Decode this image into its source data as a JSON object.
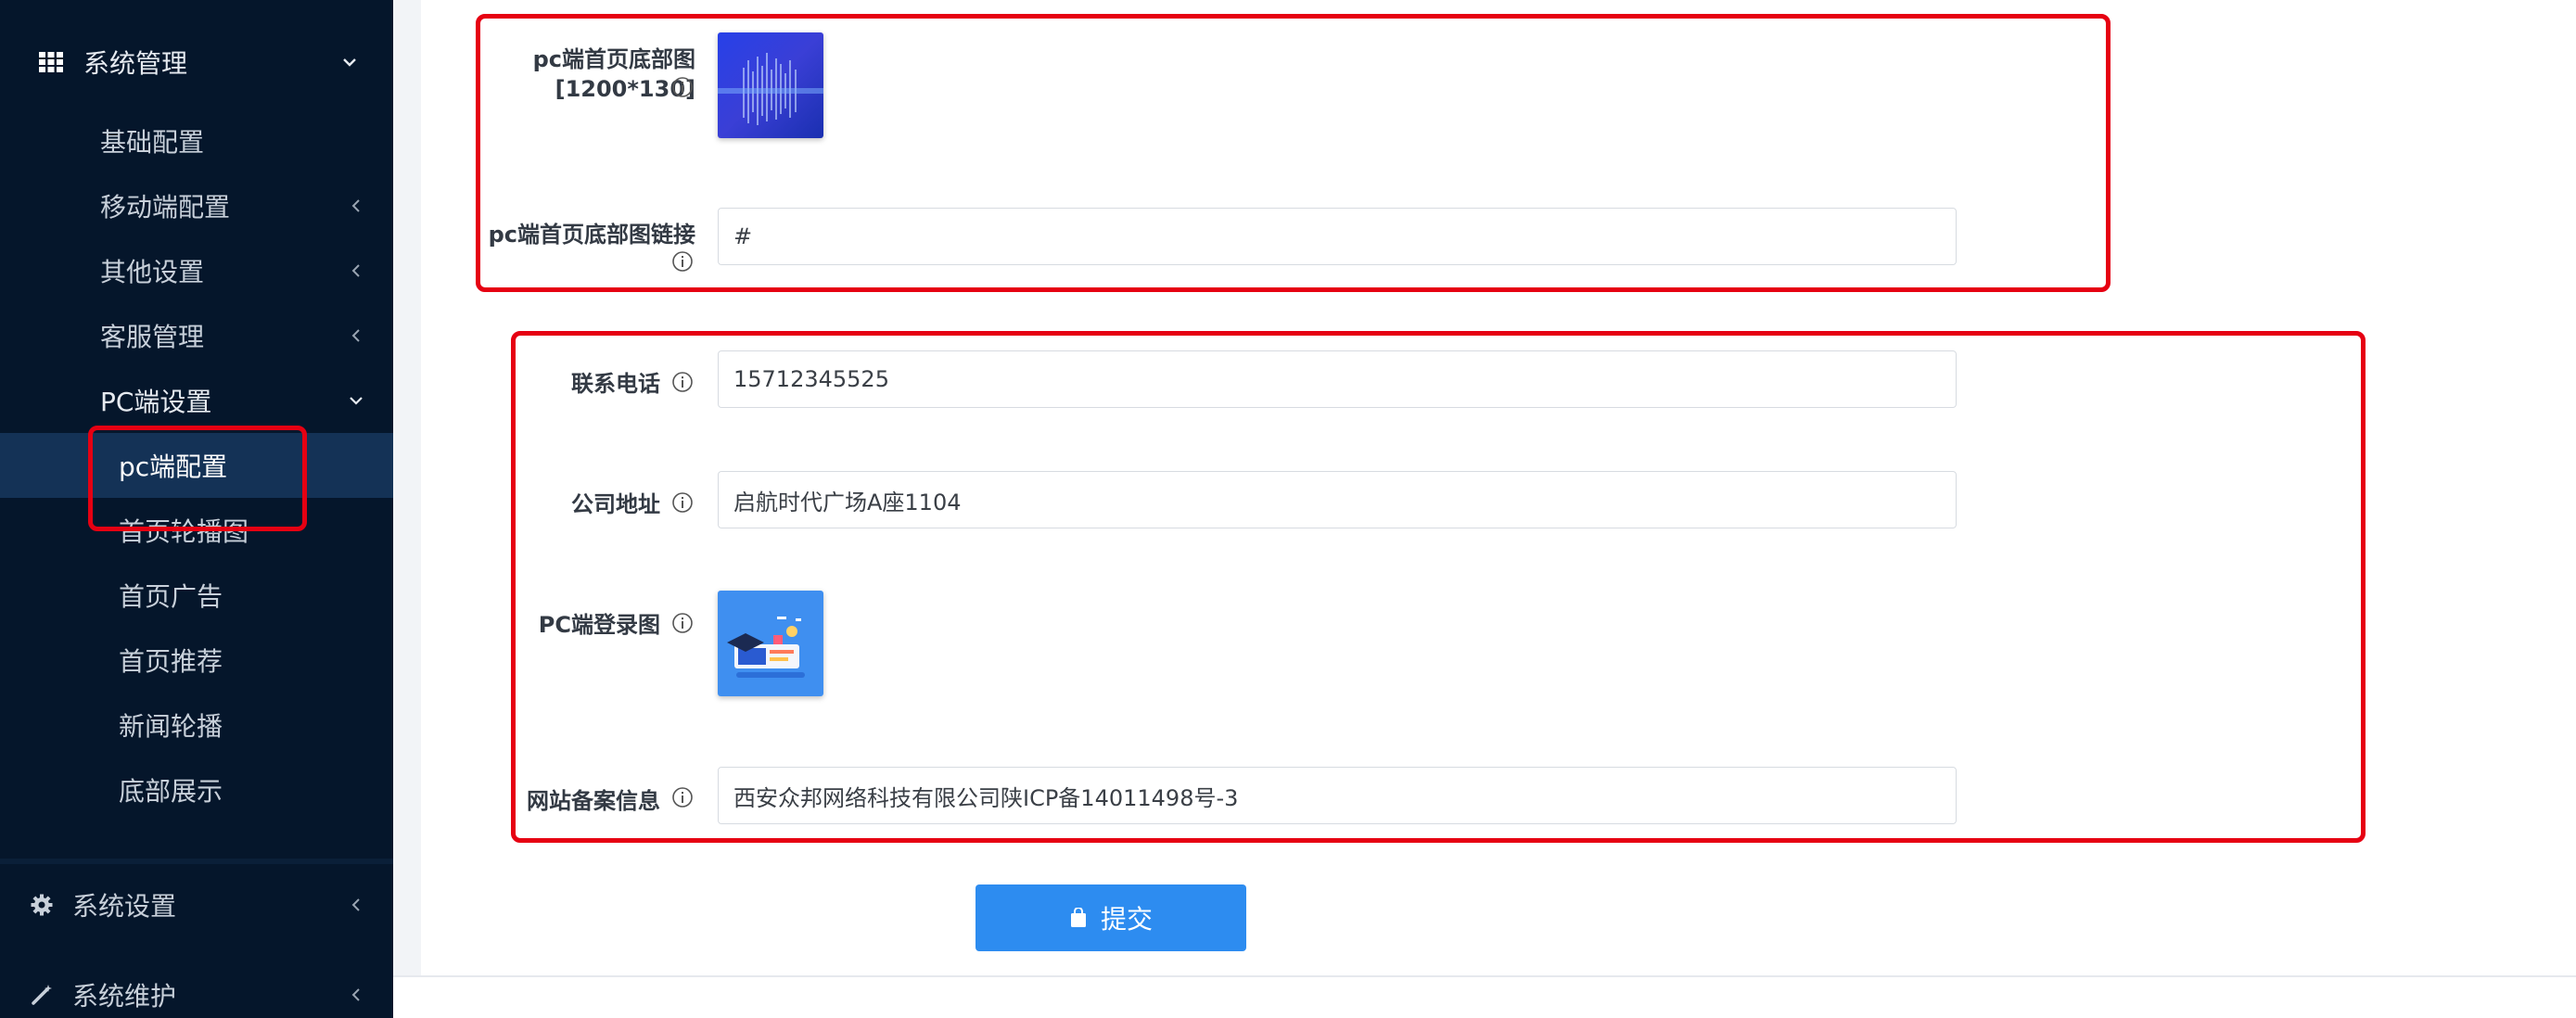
{
  "sidebar": {
    "system_management": "系统管理",
    "items": [
      {
        "label": "基础配置"
      },
      {
        "label": "移动端配置"
      },
      {
        "label": "其他设置"
      },
      {
        "label": "客服管理"
      },
      {
        "label": "PC端设置"
      }
    ],
    "pc_sub": [
      {
        "label": "pc端配置"
      },
      {
        "label": "首页轮播图"
      },
      {
        "label": "首页广告"
      },
      {
        "label": "首页推荐"
      },
      {
        "label": "新闻轮播"
      },
      {
        "label": "底部展示"
      }
    ],
    "system_settings": "系统设置",
    "system_maintenance": "系统维护",
    "active_item": "pc端配置"
  },
  "form": {
    "pc_footer_image_label_line1": "pc端首页底部图",
    "pc_footer_image_label_line2": "[1200*130]",
    "pc_footer_link_label": "pc端首页底部图链接",
    "pc_footer_link_value": "#",
    "phone_label": "联系电话",
    "phone_value": "15712345525",
    "address_label": "公司地址",
    "address_value": "启航时代广场A座1104",
    "login_image_label": "PC端登录图",
    "icp_label": "网站备案信息",
    "icp_value": "西安众邦网络科技有限公司陕ICP备14011498号-3",
    "submit_label": "提交"
  },
  "colors": {
    "sidebar_bg": "#05162b",
    "active_bg": "#143256",
    "highlight_red": "#e60012",
    "primary": "#2d8cf0"
  }
}
